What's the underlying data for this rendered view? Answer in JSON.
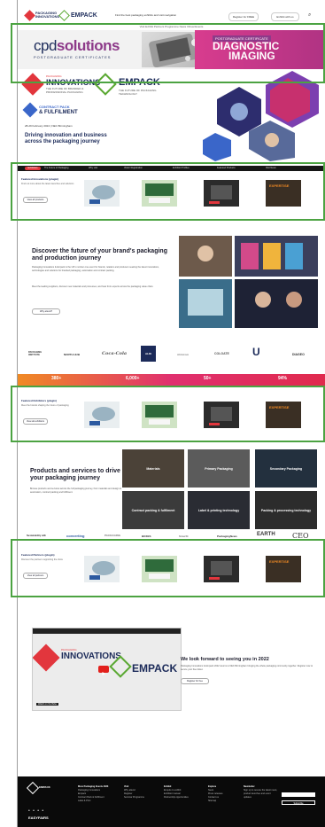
{
  "header": {
    "logo1_text": "PACKAGING INNOVATIONS",
    "logo2_text": "EMPACK",
    "search_text": "Find the best packaging exhibits and visit navigation",
    "btn_register": "Register for FREE",
    "btn_exhibit": "Exhibit with us"
  },
  "menu": {
    "text": "Visit    Exhibit    Partners    Programme    News    Virtual Events"
  },
  "banner": {
    "brand_main": "cpd",
    "brand_accent": "solutions",
    "brand_sub": "POSTGRADUATE CERTIFICATES",
    "pill": "POSTGRADUATE CERTIFICATE",
    "headline_1": "DIAGNOSTIC",
    "headline_2": "IMAGING"
  },
  "hero": {
    "pi_small": "PACKAGING",
    "pi_big": "INNOVATIONS",
    "pi_tag": "THE FUTURE OF BRANDED & PROFESSIONAL PACKAGING",
    "em_big": "EMPACK",
    "em_tag": "THE FUTURE OF PACKAGING TECHNOLOGY",
    "cp_line1": "CONTRACT PACK",
    "cp_line2": "& FULFILMENT",
    "date": "28-29 February 2024 | NEC Birmingham",
    "tagline": "Driving innovation and business across the packaging journey"
  },
  "navstrip": {
    "active": "Exhibitors",
    "items": [
      "The Future of Packaging",
      "Why visit",
      "Visitor Registration",
      "Exhibitor Profiles",
      "Featured Products",
      "Visit News"
    ]
  },
  "featured": [
    {
      "label": "Featured Innovations (plugin)",
      "text": "Find out more about the latest launches and solutions",
      "button": "View all products"
    },
    {
      "label": "Featured Exhibitors (plugin)",
      "text": "Meet the brands shaping the future of packaging",
      "button": "View all exhibitors"
    },
    {
      "label": "Featured Partners (plugin)",
      "text": "Discover the partners supporting the show",
      "button": "View all partners"
    }
  ],
  "thumbs": [
    {
      "cap": "Smart packaging sample"
    },
    {
      "cap": "How to make your packaging ready for the future"
    },
    {
      "cap": "Sustainability packaging award"
    },
    {
      "cap": "EXPERTISE"
    }
  ],
  "discover": {
    "title": "Discover the future of your brand's packaging and production journey",
    "para1": "Packaging Innovations & Empack is the UK's number one event for brands, retailers and producers seeking the latest innovations, technologies and solutions for branded packaging, automation and contract packing.",
    "para2": "Meet the leading suppliers, discover new materials and processes, and hear from experts across the packaging value chain.",
    "button": "Why attend?"
  },
  "brands": [
    "PACKAGING INSTITUTE",
    "NORTH HUB",
    "Coca-Cola",
    "ALDI",
    "Ahlstrom",
    "COLGATE",
    "Unilever",
    "DIAGEO"
  ],
  "stats": [
    {
      "value": "380+",
      "label": "Exhibitors"
    },
    {
      "value": "6,000+",
      "label": "Visitors"
    },
    {
      "value": "50+",
      "label": "Speakers"
    },
    {
      "value": "94%",
      "label": "Satisfaction"
    }
  ],
  "products": {
    "title": "Products and services to drive your packaging journey",
    "para": "Browse products and services across the full packaging journey, from materials and design to automation, contract packing and fulfilment.",
    "tiles": [
      "Materials",
      "Primary Packaging",
      "Secondary Packaging",
      "Contract packing & fulfilment",
      "Label & printing technology",
      "Packing & processing technology"
    ]
  },
  "sponsors": [
    "Sustainability with",
    "converting",
    "PACKAGING",
    "BOXES",
    "Smurfit",
    "PackagingNews",
    "EARTH",
    "CEO"
  ],
  "video": {
    "pi": "INNOVATIONS",
    "pi_small": "PACKAGING",
    "em": "EMPACK",
    "caption": "Watch on YouTube"
  },
  "cta": {
    "title": "We look forward to seeing you in 2022",
    "para": "Packaging Innovations & Empack 2022 returns to NEC Birmingham bringing the whole packaging community together. Register now to secure your free ticket.",
    "button": "Register for free"
  },
  "footer": {
    "col1_head": "More Packaging Events 2023",
    "col1": [
      "Packaging Innovations",
      "Empack",
      "Contract Pack & Fulfilment",
      "Label & Print"
    ],
    "col2_head": "Visit",
    "col2": [
      "Why attend",
      "Register",
      "Seminar Programme"
    ],
    "col3_head": "Exhibit",
    "col3": [
      "Enquire to exhibit",
      "Exhibitor manual",
      "Partnership opportunities"
    ],
    "col4_head": "Explore",
    "col4": [
      "News",
      "Press releases",
      "Contact us",
      "Sitemap"
    ],
    "col5_head": "Newsletter",
    "col5": "Sign up to receive the latest news, product launches and event updates",
    "subscribe": "Subscribe",
    "organiser": "EASYFAIRS"
  }
}
